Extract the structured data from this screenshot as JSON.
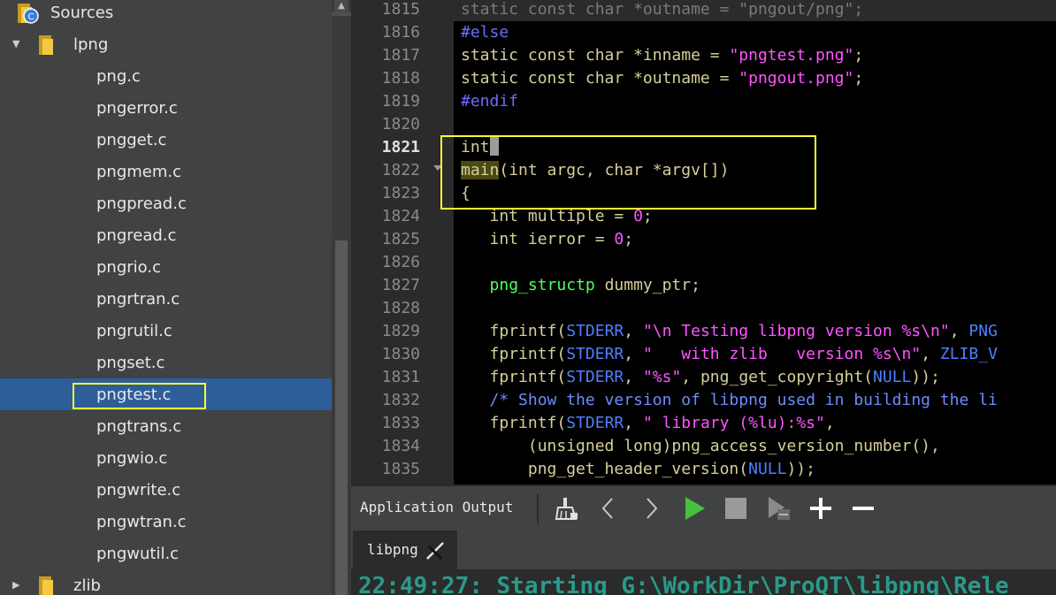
{
  "tree": {
    "root_label": "Sources",
    "project_label": "lpng",
    "files": [
      "png.c",
      "pngerror.c",
      "pngget.c",
      "pngmem.c",
      "pngpread.c",
      "pngread.c",
      "pngrio.c",
      "pngrtran.c",
      "pngrutil.c",
      "pngset.c",
      "pngtest.c",
      "pngtrans.c",
      "pngwio.c",
      "pngwrite.c",
      "pngwtran.c",
      "pngwutil.c"
    ],
    "selected_file": "pngtest.c",
    "next_folder_label": "zlib"
  },
  "editor": {
    "current_line": "1821",
    "line_numbers": [
      "1815",
      "1816",
      "1817",
      "1818",
      "1819",
      "1820",
      "1821",
      "1822",
      "1823",
      "1824",
      "1825",
      "1826",
      "1827",
      "1828",
      "1829",
      "1830",
      "1831",
      "1832",
      "1833",
      "1834",
      "1835"
    ],
    "lines": {
      "l1815": "static const char *outname = \"pngout/png\";",
      "l1816": "#else",
      "l1817_a": "static const char ",
      "l1817_b": "*inname = ",
      "l1817_c": "\"pngtest.png\"",
      "l1817_d": ";",
      "l1818_a": "static const char ",
      "l1818_b": "*outname = ",
      "l1818_c": "\"pngout.png\"",
      "l1818_d": ";",
      "l1819": "#endif",
      "l1821": "int",
      "l1822_a": "main",
      "l1822_b": "(int argc, char *argv[])",
      "l1823": "{",
      "l1824_a": "   int multiple = ",
      "l1824_b": "0",
      "l1824_c": ";",
      "l1825_a": "   int ierror = ",
      "l1825_b": "0",
      "l1825_c": ";",
      "l1827_a": "   ",
      "l1827_b": "png_structp",
      "l1827_c": " dummy_ptr;",
      "l1829_a": "   fprintf(",
      "l1829_b": "STDERR",
      "l1829_c": ", ",
      "l1829_d": "\"\\n Testing libpng version %s\\n\"",
      "l1829_e": ", ",
      "l1829_f": "PNG",
      "l1830_a": "   fprintf(",
      "l1830_b": "STDERR",
      "l1830_c": ", ",
      "l1830_d": "\"   with zlib   version %s\\n\"",
      "l1830_e": ", ",
      "l1830_f": "ZLIB_V",
      "l1831_a": "   fprintf(",
      "l1831_b": "STDERR",
      "l1831_c": ", ",
      "l1831_d": "\"%s\"",
      "l1831_e": ", png_get_copyright(",
      "l1831_f": "NULL",
      "l1831_g": "));",
      "l1832": "   /* Show the version of libpng used in building the li",
      "l1833_a": "   fprintf(",
      "l1833_b": "STDERR",
      "l1833_c": ", ",
      "l1833_d": "\" library (%lu):%s\"",
      "l1833_e": ",",
      "l1834": "       (unsigned long)png_access_version_number(),",
      "l1835_a": "       png_get_header_version(",
      "l1835_b": "NULL",
      "l1835_c": "));"
    }
  },
  "output": {
    "panel_title": "Application Output",
    "tab_label": "libpng",
    "log_line": "22:49:27: Starting G:\\WorkDir\\ProQT\\libpng\\Rele"
  },
  "icons": {
    "clean": "broom-icon",
    "prev": "chevron-left-icon",
    "next": "chevron-right-icon",
    "run": "play-icon",
    "stop": "stop-icon",
    "attach": "debug-attach-icon",
    "zoom_in": "plus-icon",
    "zoom_out": "minus-icon"
  },
  "colors": {
    "selection": "#2d5e9a",
    "highlight": "#ffff33",
    "run_green": "#44c23e"
  }
}
